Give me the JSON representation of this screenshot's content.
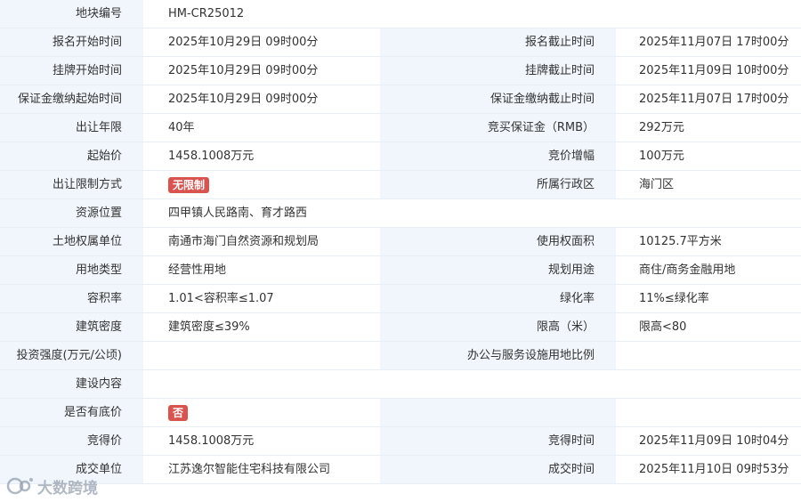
{
  "rows": [
    {
      "l1": "地块编号",
      "v1": "HM-CR25012",
      "l2": "",
      "v2": "",
      "full": true
    },
    {
      "l1": "报名开始时间",
      "v1": "2025年10月29日 09时00分",
      "l2": "报名截止时间",
      "v2": "2025年11月07日 17时00分"
    },
    {
      "l1": "挂牌开始时间",
      "v1": "2025年10月29日 09时00分",
      "l2": "挂牌截止时间",
      "v2": "2025年11月09日 10时00分"
    },
    {
      "l1": "保证金缴纳起始时间",
      "v1": "2025年10月29日 09时00分",
      "l2": "保证金缴纳截止时间",
      "v2": "2025年11月07日 17时00分"
    },
    {
      "l1": "出让年限",
      "v1": "40年",
      "l2": "竞买保证金（RMB）",
      "v2": "292万元"
    },
    {
      "l1": "起始价",
      "v1": "1458.1008万元",
      "l2": "竞价增幅",
      "v2": "100万元"
    },
    {
      "l1": "出让限制方式",
      "v1": "无限制",
      "v1_badge": true,
      "l2": "所属行政区",
      "v2": "海门区"
    },
    {
      "l1": "资源位置",
      "v1": "四甲镇人民路南、育才路西",
      "l2": "",
      "v2": "",
      "full": true
    },
    {
      "l1": "土地权属单位",
      "v1": "南通市海门自然资源和规划局",
      "l2": "使用权面积",
      "v2": "10125.7平方米"
    },
    {
      "l1": "用地类型",
      "v1": "经营性用地",
      "l2": "规划用途",
      "v2": "商住/商务金融用地"
    },
    {
      "l1": "容积率",
      "v1": "1.01<容积率≤1.07",
      "l2": "绿化率",
      "v2": "11%≤绿化率"
    },
    {
      "l1": "建筑密度",
      "v1": "建筑密度≤39%",
      "l2": "限高（米）",
      "v2": "限高<80"
    },
    {
      "l1": "投资强度(万元/公顷)",
      "v1": "",
      "l2": "办公与服务设施用地比例",
      "v2": ""
    },
    {
      "l1": "建设内容",
      "v1": "",
      "l2": "",
      "v2": "",
      "full": true
    },
    {
      "l1": "是否有底价",
      "v1": "否",
      "v1_badge": true,
      "l2": "",
      "v2": ""
    },
    {
      "l1": "竞得价",
      "v1": "1458.1008万元",
      "l2": "竞得时间",
      "v2": "2025年11月09日 10时04分"
    },
    {
      "l1": "成交单位",
      "v1": "江苏逸尔智能住宅科技有限公司",
      "l2": "成交时间",
      "v2": "2025年11月10日 09时53分"
    }
  ],
  "watermark": {
    "text": "大数跨境",
    "logo_icon": "watermark-logo-icon"
  },
  "colors": {
    "label_bg": "#f0f6fc",
    "badge_bg": "#d9534f",
    "border": "#e9eef4"
  }
}
